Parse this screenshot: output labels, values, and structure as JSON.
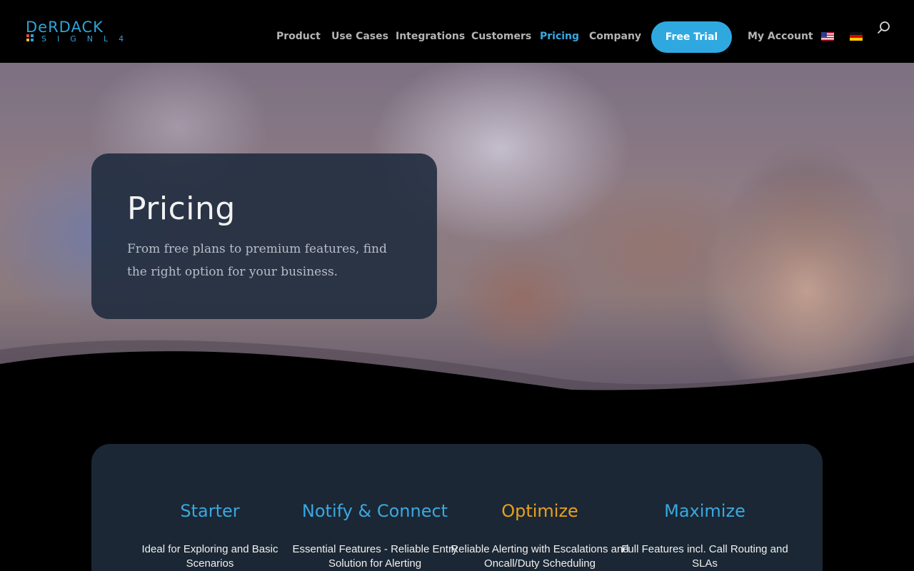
{
  "logo": {
    "word": "DeRDACK",
    "sub": "SIGNL4",
    "dot_colors": [
      "#e6483d",
      "#2fa3d8",
      "#f2b632",
      "#2fa3d8"
    ]
  },
  "nav": {
    "items": [
      {
        "label": "Product"
      },
      {
        "label": "Use Cases"
      },
      {
        "label": "Integrations"
      },
      {
        "label": "Customers"
      },
      {
        "label": "Pricing",
        "active": true
      },
      {
        "label": "Company"
      }
    ],
    "cta": "Free Trial",
    "account": "My Account"
  },
  "hero": {
    "title": "Pricing",
    "subtitle": "From free plans to premium features, find the right option for your business."
  },
  "plans": [
    {
      "name": "Starter",
      "desc": "Ideal for Exploring and Basic Scenarios",
      "color": "#3aa8e0"
    },
    {
      "name": "Notify & Connect",
      "desc": "Essential Features - Reliable Entry Solution for Alerting",
      "color": "#3aa8e0"
    },
    {
      "name": "Optimize",
      "desc": "Reliable Alerting with Escalations and Oncall/Duty Scheduling",
      "color": "#e8a020"
    },
    {
      "name": "Maximize",
      "desc": "Full Features incl. Call Routing and SLAs",
      "color": "#3aa8e0"
    }
  ],
  "colors": {
    "accent": "#2fa8e0",
    "highlight": "#e8a020",
    "panel": "#1b2734"
  }
}
